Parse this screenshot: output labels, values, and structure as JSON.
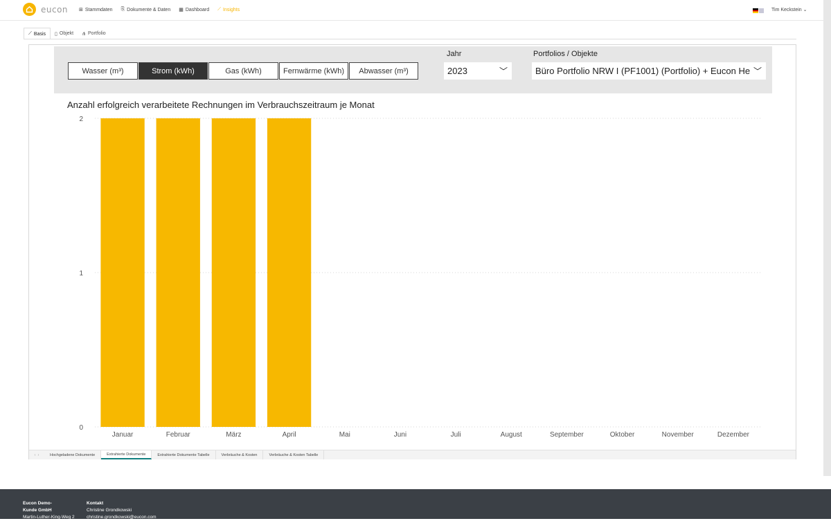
{
  "header": {
    "logo_text": "eucon",
    "nav": [
      {
        "label": "Stammdaten",
        "icon": "sitemap-icon"
      },
      {
        "label": "Dokumente & Daten",
        "icon": "documents-icon"
      },
      {
        "label": "Dashboard",
        "icon": "dashboard-icon"
      },
      {
        "label": "Insights",
        "icon": "chart-icon",
        "active": true
      }
    ],
    "user": "Tim Keckstein"
  },
  "tabs": [
    {
      "label": "Basis",
      "active": true
    },
    {
      "label": "Objekt"
    },
    {
      "label": "Portfolio"
    }
  ],
  "filters": {
    "media_buttons": [
      "Wasser (m³)",
      "Strom (kWh)",
      "Gas (kWh)",
      "Fernwärme (kWh)",
      "Abwasser (m³)"
    ],
    "active_media": "Strom (kWh)",
    "year_label": "Jahr",
    "year_value": "2023",
    "portfolio_label": "Portfolios / Objekte",
    "portfolio_value": "Büro Portfolio NRW I (PF1001) (Portfolio) + Eucon He..."
  },
  "chart_data": {
    "type": "bar",
    "title": "Anzahl erfolgreich verarbeitete Rechnungen im Verbrauchszeitraum je Monat",
    "categories": [
      "Januar",
      "Februar",
      "März",
      "April",
      "Mai",
      "Juni",
      "Juli",
      "August",
      "September",
      "Oktober",
      "November",
      "Dezember"
    ],
    "values": [
      2,
      2,
      2,
      2,
      0,
      0,
      0,
      0,
      0,
      0,
      0,
      0
    ],
    "ylim": [
      0,
      2
    ],
    "yticks": [
      "0",
      "1",
      "2"
    ],
    "color": "#F7B800",
    "grid": true
  },
  "page_tabs": [
    "Hochgeladene Dokumente",
    "Extrahierte Dokumente",
    "Extrahierte Dokumente Tabelle",
    "Verbräuche & Kosten",
    "Verbräuche & Kosten Tabelle"
  ],
  "active_page_tab": "Extrahierte Dokumente",
  "footer": {
    "company": [
      "Eucon Demo-",
      "Kunde GmbH",
      "Martin-Luther-King-Weg 2"
    ],
    "contact_title": "Kontakt",
    "contact": [
      "Christine Grondkowski",
      "christine.grondkowski@eucon.com"
    ]
  },
  "colors": {
    "accent": "#F7B500",
    "footer": "#3B4046",
    "active_button": "#333333"
  }
}
